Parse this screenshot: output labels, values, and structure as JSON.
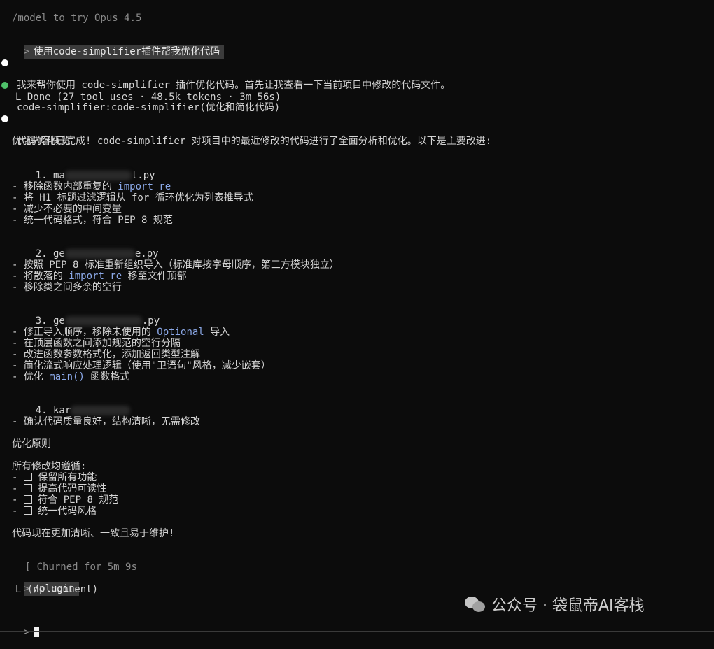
{
  "lines": {
    "model_hint": "/model to try Opus 4.5",
    "user_cmd": "使用code-simplifier插件帮我优化代码",
    "assistant_1": "我来帮你使用 code-simplifier 插件优化代码。首先让我查看一下当前项目中修改的代码文件。",
    "tool_call": "code-simplifier:code-simplifier(优化和简化代码)",
    "tool_result": "L Done (27 tool uses · 48.5k tokens · 3m 56s)",
    "assistant_2": "代码优化已完成! code-simplifier 对项目中的最近修改的代码进行了全面分析和优化。以下是主要改进:",
    "overview_heading": "优化内容概览",
    "file1_prefix": "1. ma",
    "file1_suffix": "l.py",
    "file1_b1": "- 移除函数内部重复的 ",
    "file1_b1_code": "import re",
    "file1_b2": "- 将 H1 标题过滤逻辑从 for 循环优化为列表推导式",
    "file1_b3": "- 减少不必要的中间变量",
    "file1_b4": "- 统一代码格式，符合 PEP 8 规范",
    "file2_prefix": "2. ge",
    "file2_suffix": "e.py",
    "file2_b1": "- 按照 PEP 8 标准重新组织导入（标准库按字母顺序，第三方模块独立）",
    "file2_b2_pre": "- 将散落的 ",
    "file2_b2_code": "import re",
    "file2_b2_post": " 移至文件顶部",
    "file2_b3": "- 移除类之间多余的空行",
    "file3_prefix": "3. ge",
    "file3_suffix": ".py",
    "file3_b1_pre": "- 修正导入顺序，移除未使用的 ",
    "file3_b1_code": "Optional",
    "file3_b1_post": " 导入",
    "file3_b2": "- 在顶层函数之间添加规范的空行分隔",
    "file3_b3": "- 改进函数参数格式化，添加返回类型注解",
    "file3_b4": "- 简化流式响应处理逻辑（使用\"卫语句\"风格，减少嵌套）",
    "file3_b5_pre": "- 优化 ",
    "file3_b5_code": "main()",
    "file3_b5_post": " 函数格式",
    "file4_prefix": "4. kar",
    "file4_b1": "- 确认代码质量良好，结构清晰，无需修改",
    "principles_heading": "优化原则",
    "principles_intro": "所有修改均遵循:",
    "principle_1": "保留所有功能",
    "principle_2": "提高代码可读性",
    "principle_3": "符合 PEP 8 规范",
    "principle_4": "统一代码风格",
    "closing": "代码现在更加清晰、一致且易于维护!",
    "churned": "Churned for 5m 9s",
    "plugin_cmd": "/plugin",
    "plugin_result": "L (no content)"
  },
  "prompt_symbol": ">",
  "list_dash": "- ",
  "watermark": {
    "text": "公众号 · 袋鼠帝AI客栈",
    "icon": "wechat-icon"
  },
  "colors": {
    "background": "#0c0c0c",
    "text": "#d4d4d4",
    "keyword": "#8aa7e6",
    "status_dot_green": "#4fc16a"
  }
}
